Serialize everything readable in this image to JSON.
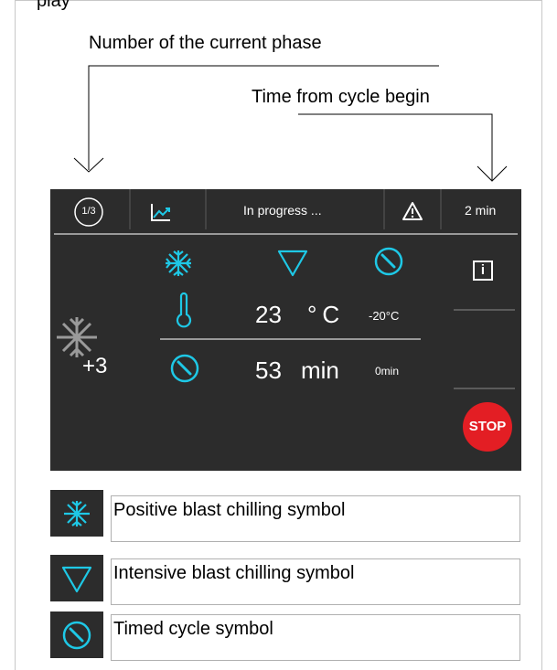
{
  "top_partial_text": "play",
  "callouts": {
    "phase": "Number of the current phase",
    "time": "Time from cycle begin"
  },
  "device": {
    "phase_indicator": "1/3",
    "status_text": "In progress ...",
    "elapsed_time": "2 min",
    "temperature_value": "23",
    "temperature_unit": "°C",
    "temperature_target": "-20°C",
    "time_value": "53",
    "time_unit": "min",
    "time_target": "0min",
    "snow_level": "+3",
    "info_label": "i",
    "stop_label": "STOP"
  },
  "legend": [
    {
      "icon": "snowflake-icon",
      "text": "Positive blast chilling symbol"
    },
    {
      "icon": "triangle-down-icon",
      "text": "Intensive blast chilling symbol"
    },
    {
      "icon": "clock-icon",
      "text": "Timed cycle symbol"
    }
  ],
  "colors": {
    "panel_bg": "#2c2c2c",
    "accent_cyan": "#1ec8e6",
    "stop_red": "#e31e24"
  }
}
